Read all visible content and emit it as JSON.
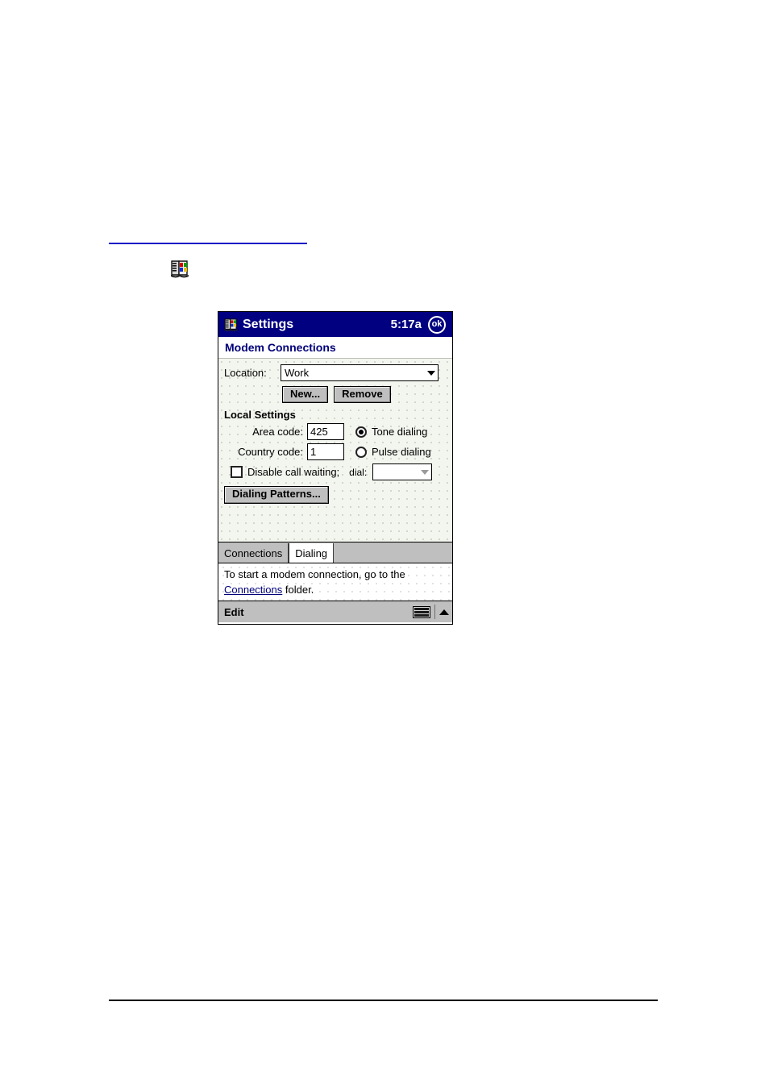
{
  "page": {
    "top_rule_color": "#1414c8",
    "bottom_rule_color": "#000000",
    "inline_icon_name": "settings-book-icon"
  },
  "device": {
    "titlebar": {
      "icon": "settings-book-icon",
      "title": "Settings",
      "clock": "5:17a",
      "ok_label": "ok",
      "background_color": "#000080"
    },
    "page_heading": "Modem Connections",
    "form": {
      "location_label": "Location:",
      "location_value": "Work",
      "new_button": "New...",
      "remove_button": "Remove",
      "section_title": "Local Settings",
      "area_code_label": "Area code:",
      "area_code_value": "425",
      "country_code_label": "Country code:",
      "country_code_value": "1",
      "tone_dialing_label": "Tone dialing",
      "tone_dialing_selected": true,
      "pulse_dialing_label": "Pulse dialing",
      "pulse_dialing_selected": false,
      "disable_call_waiting_label": "Disable call waiting;",
      "disable_call_waiting_checked": false,
      "dial_label": "dial:",
      "dial_value": "",
      "dialing_patterns_button": "Dialing Patterns..."
    },
    "tabs": [
      {
        "label": "Connections",
        "active": false
      },
      {
        "label": "Dialing",
        "active": true
      }
    ],
    "hint": {
      "text_before": "To start a modem connection, go to the",
      "link_text": "Connections",
      "text_after": " folder."
    },
    "commandbar": {
      "edit_label": "Edit",
      "keyboard_icon": "keyboard-icon",
      "up_icon": "chevron-up-icon"
    }
  }
}
